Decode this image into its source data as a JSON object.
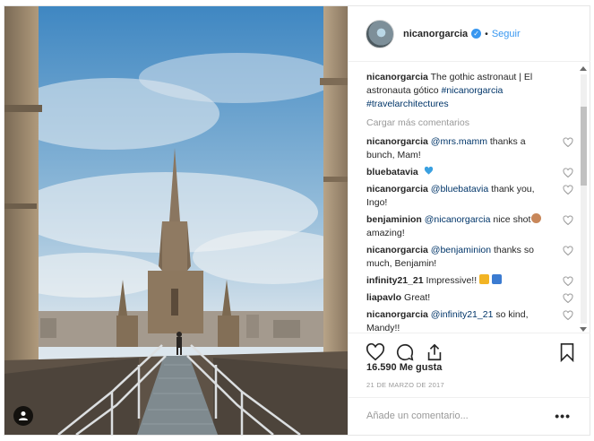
{
  "post": {
    "username": "nicanorgarcia",
    "separator": "•",
    "follow_label": "Seguir",
    "caption_user": "nicanorgarcia",
    "caption_text": " The gothic astronaut | El astronauta gótico ",
    "caption_tags": [
      "#nicanorgarcia",
      "#travelarchitectures"
    ],
    "load_more": "Cargar más comentarios",
    "likes": "16.590 Me gusta",
    "date": "21 DE MARZO DE 2017",
    "add_comment_placeholder": "Añade un comentario...",
    "more_dots": "•••"
  },
  "comments": [
    {
      "user": "nicanorgarcia",
      "mention": "@mrs.mamm",
      "text": " thanks a bunch, Mam!"
    },
    {
      "user": "bluebatavia",
      "mention": "",
      "text": "",
      "emoji": "blue-heart"
    },
    {
      "user": "nicanorgarcia",
      "mention": "@bluebatavia",
      "text": " thank you, Ingo!"
    },
    {
      "user": "benjaminion",
      "mention": "@nicanorgarcia",
      "text": " nice shot",
      "text2": "amazing!",
      "emoji": "face"
    },
    {
      "user": "nicanorgarcia",
      "mention": "@benjaminion",
      "text": " thanks so much, Benjamin!"
    },
    {
      "user": "infinity21_21",
      "mention": "",
      "text": " Impressive!!",
      "emoji": "thumbs-and-1"
    },
    {
      "user": "liapavlo",
      "mention": "",
      "text": " Great!"
    },
    {
      "user": "nicanorgarcia",
      "mention": "@infinity21_21",
      "text": " so kind, Mandy!!"
    }
  ],
  "icons": {
    "like": "heart-icon",
    "comment": "comment-bubble-icon",
    "share": "share-icon",
    "save": "bookmark-icon",
    "user_tag": "person-icon"
  },
  "colors": {
    "link_blue": "#3897f0",
    "tag_blue": "#003569",
    "muted": "#999999"
  }
}
